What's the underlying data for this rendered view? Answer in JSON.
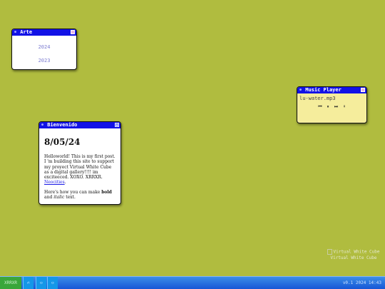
{
  "windows": {
    "arte": {
      "title": "Arte",
      "years": [
        "2024",
        "2023"
      ]
    },
    "music": {
      "title": "Music Player",
      "track": "lu-water.mp3",
      "controls": {
        "prev": "⏮",
        "pause": "⏸",
        "next": "⏭",
        "download": "⬇"
      }
    },
    "bienvenido": {
      "title": "Bienvenido",
      "date": "8/05/24",
      "p1_text": "Helloworld! This is my first post. I 'm building this site to support my proyect Virtual White Cube as a digital gallery!!!! im exciteeced. XOXO. XRRXR. ",
      "p1_link": "Neocities",
      "p1_end": ".",
      "p2_start": "Here's how you can make ",
      "p2_bold": "bold",
      "p2_mid": " and ",
      "p2_italic": "italic",
      "p2_end": " text."
    }
  },
  "desktop_icon": {
    "alt_text": "Virtual White Cube",
    "label": "Virtual White Cube"
  },
  "taskbar": {
    "start_label": "XRRXR",
    "clock": "v0.1 2024 14:43"
  },
  "colors": {
    "desktop": "#b0bc3f",
    "titlebar": "#1212e6",
    "taskbar": "#1656d6",
    "start": "#3aa63a"
  }
}
